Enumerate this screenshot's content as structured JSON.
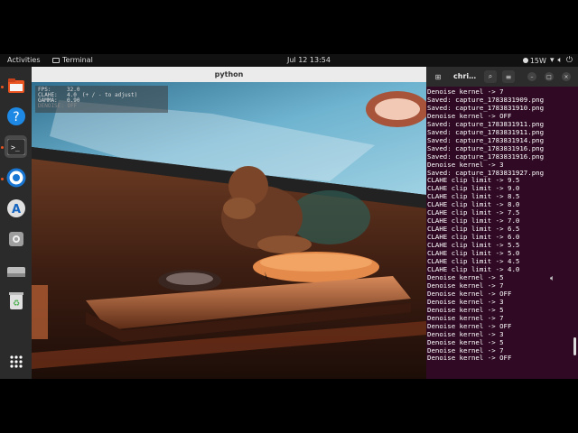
{
  "topbar": {
    "activities": "Activities",
    "app_name": "Terminal",
    "clock": "Jul 12  13:54",
    "weather": "15W",
    "icons": [
      "network-icon",
      "volume-icon",
      "power-icon"
    ]
  },
  "dock": {
    "items": [
      {
        "name": "files-icon",
        "color": "#e95420"
      },
      {
        "name": "help-icon",
        "color": "#1e88e5"
      },
      {
        "name": "terminal-icon",
        "color": "#333333"
      },
      {
        "name": "chrome-icon",
        "color": "#1976d2"
      },
      {
        "name": "software-center-icon",
        "color": "#1565c0"
      },
      {
        "name": "settings-icon",
        "color": "#9e9e9e"
      },
      {
        "name": "drive-icon",
        "color": "#bdbdbd"
      },
      {
        "name": "trash-icon",
        "color": "#4caf50"
      },
      {
        "name": "show-apps-icon",
        "color": "#ffffff"
      }
    ]
  },
  "python_window": {
    "title": "python",
    "hud": {
      "fps_label": "FPS:",
      "fps_value": "32.0",
      "clahe_label": "CLAHE:",
      "clahe_value": "4.0",
      "clahe_hint": "(+ / - to adjust)",
      "gamma_label": "GAMMA:",
      "gamma_value": "0.90",
      "denoise_label": "DENOISE: OFF"
    }
  },
  "terminal": {
    "title": "chri…",
    "lines": [
      "Denoise kernel -> 7",
      "Saved: capture_1783831909.png",
      "Saved: capture_1783831910.png",
      "Denoise kernel -> OFF",
      "Saved: capture_1783831911.png",
      "Saved: capture_1783831911.png",
      "Saved: capture_1783831914.png",
      "Saved: capture_1783831916.png",
      "Saved: capture_1783831916.png",
      "Denoise kernel -> 3",
      "Saved: capture_1783831927.png",
      "CLAHE clip limit -> 9.5",
      "CLAHE clip limit -> 9.0",
      "CLAHE clip limit -> 8.5",
      "CLAHE clip limit -> 8.0",
      "CLAHE clip limit -> 7.5",
      "CLAHE clip limit -> 7.0",
      "CLAHE clip limit -> 6.5",
      "CLAHE clip limit -> 6.0",
      "CLAHE clip limit -> 5.5",
      "CLAHE clip limit -> 5.0",
      "CLAHE clip limit -> 4.5",
      "CLAHE clip limit -> 4.0",
      "Denoise kernel -> 5",
      "Denoise kernel -> 7",
      "Denoise kernel -> OFF",
      "Denoise kernel -> 3",
      "Denoise kernel -> 5",
      "Denoise kernel -> 7",
      "Denoise kernel -> OFF",
      "Denoise kernel -> 3",
      "Denoise kernel -> 5",
      "Denoise kernel -> 7",
      "Denoise kernel -> OFF"
    ]
  }
}
